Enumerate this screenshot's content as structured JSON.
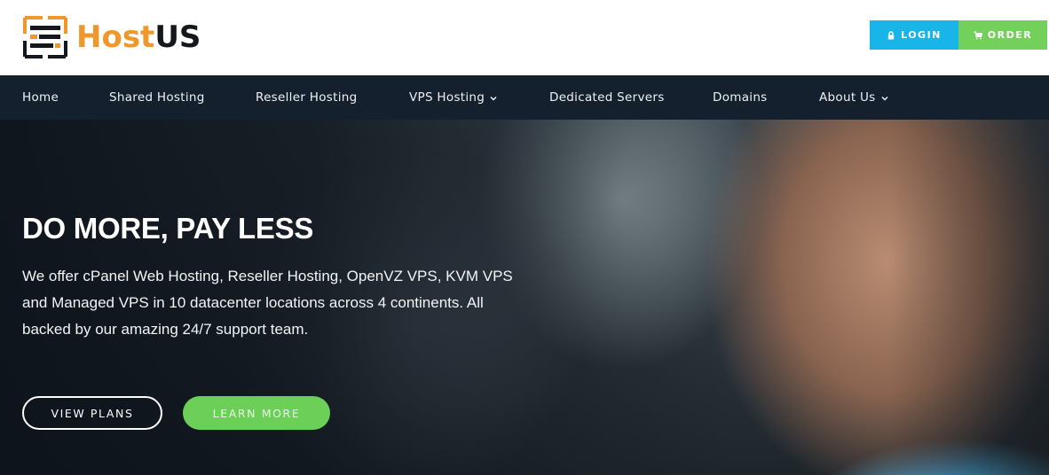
{
  "brand": {
    "name_part1": "Host",
    "name_part2": "US",
    "logo_icon": "server-rack-logo-icon",
    "colors": {
      "orange": "#f0972b",
      "dark": "#14181c"
    }
  },
  "header": {
    "login_label": "LOGIN",
    "login_icon": "lock-icon",
    "order_label": "ORDER",
    "order_icon": "cart-icon",
    "colors": {
      "login": "#1ab5e8",
      "order": "#73d15b"
    }
  },
  "nav": {
    "items": [
      {
        "label": "Home",
        "dropdown": false
      },
      {
        "label": "Shared Hosting",
        "dropdown": false
      },
      {
        "label": "Reseller Hosting",
        "dropdown": false
      },
      {
        "label": "VPS Hosting",
        "dropdown": true
      },
      {
        "label": "Dedicated Servers",
        "dropdown": false
      },
      {
        "label": "Domains",
        "dropdown": false
      },
      {
        "label": "About Us",
        "dropdown": true
      }
    ],
    "background": "#14202d"
  },
  "hero": {
    "title": "DO MORE, PAY LESS",
    "description": "We offer cPanel Web Hosting, Reseller Hosting, OpenVZ VPS, KVM VPS and Managed VPS in 10 datacenter locations across 4 continents. All backed by our amazing 24/7 support team.",
    "view_plans_label": "VIEW PLANS",
    "learn_more_label": "LEARN MORE",
    "learn_more_color": "#6ccf57"
  }
}
